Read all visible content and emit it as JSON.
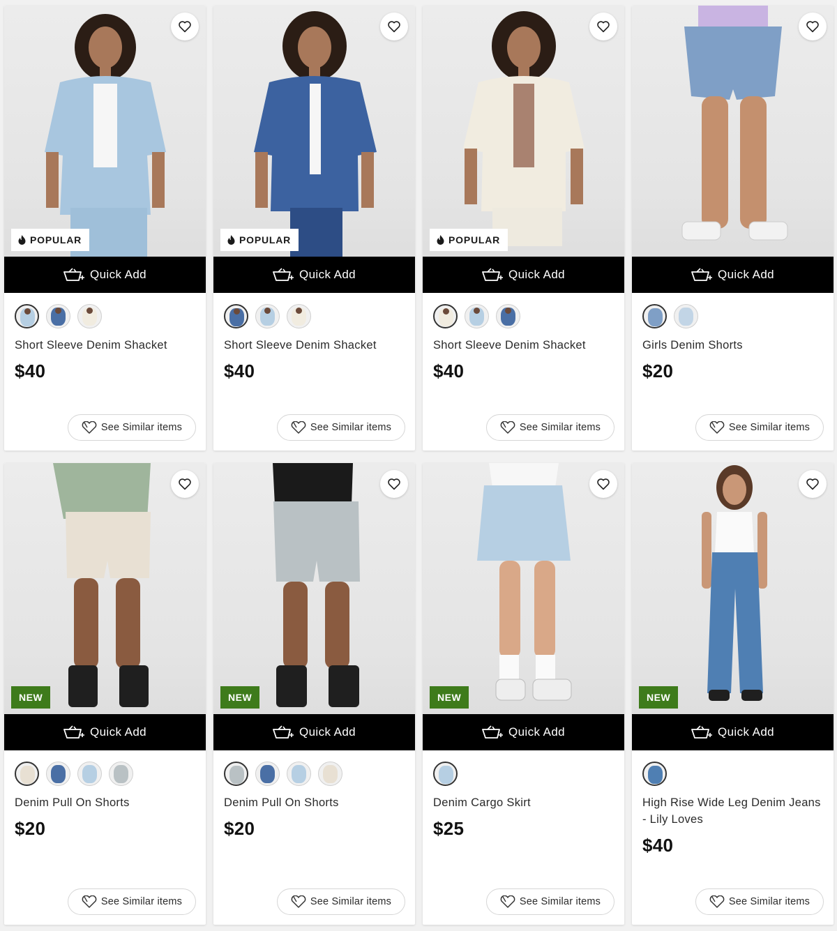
{
  "common": {
    "quick_add_label": "Quick Add",
    "see_similar_label": "See Similar items",
    "popular_label": "POPULAR",
    "new_label": "NEW"
  },
  "colors": {
    "quick_add_bg": "#000000",
    "new_badge_bg": "#3e7b1b",
    "card_bg": "#ffffff"
  },
  "products": [
    {
      "title": "Short Sleeve Denim Shacket",
      "price": "$40",
      "badge": "popular",
      "swatches": [
        "light-denim",
        "mid-denim",
        "cream"
      ],
      "selected_swatch": 0
    },
    {
      "title": "Short Sleeve Denim Shacket",
      "price": "$40",
      "badge": "popular",
      "swatches": [
        "mid-denim",
        "light-denim",
        "cream"
      ],
      "selected_swatch": 0
    },
    {
      "title": "Short Sleeve Denim Shacket",
      "price": "$40",
      "badge": "popular",
      "swatches": [
        "cream",
        "light-denim",
        "mid-denim"
      ],
      "selected_swatch": 0
    },
    {
      "title": "Girls Denim Shorts",
      "price": "$20",
      "badge": "none",
      "swatches": [
        "mid-denim",
        "light-denim"
      ],
      "selected_swatch": 0
    },
    {
      "title": "Denim Pull On Shorts",
      "price": "$20",
      "badge": "new",
      "swatches": [
        "stone",
        "mid-denim",
        "light-denim",
        "grey-denim"
      ],
      "selected_swatch": 0
    },
    {
      "title": "Denim Pull On Shorts",
      "price": "$20",
      "badge": "new",
      "swatches": [
        "grey-denim",
        "mid-denim",
        "light-denim",
        "stone"
      ],
      "selected_swatch": 0
    },
    {
      "title": "Denim Cargo Skirt",
      "price": "$25",
      "badge": "new",
      "swatches": [
        "light-denim"
      ],
      "selected_swatch": 0
    },
    {
      "title": "High Rise Wide Leg Denim Jeans - Lily Loves",
      "price": "$40",
      "badge": "new",
      "swatches": [
        "mid-denim"
      ],
      "selected_swatch": 0
    }
  ]
}
